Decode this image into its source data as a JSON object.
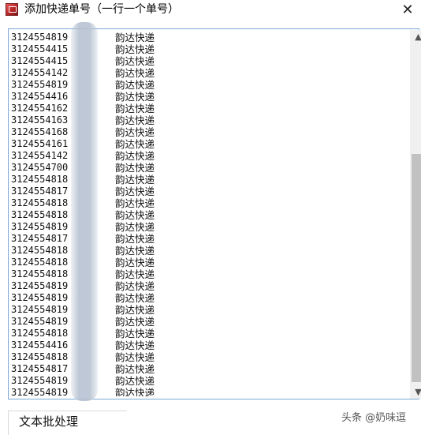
{
  "window": {
    "title": "添加快递单号（一行一个单号）",
    "close_symbol": "✕"
  },
  "tracking_list": {
    "courier": "韵达快递",
    "rows": [
      {
        "number": "3124554819",
        "courier": "韵达快递"
      },
      {
        "number": "3124554415",
        "courier": "韵达快递"
      },
      {
        "number": "3124554415",
        "courier": "韵达快递"
      },
      {
        "number": "3124554142",
        "courier": "韵达快递"
      },
      {
        "number": "3124554819",
        "courier": "韵达快递"
      },
      {
        "number": "3124554416",
        "courier": "韵达快递"
      },
      {
        "number": "3124554162",
        "courier": "韵达快递"
      },
      {
        "number": "3124554163",
        "courier": "韵达快递"
      },
      {
        "number": "3124554168",
        "courier": "韵达快递"
      },
      {
        "number": "3124554161",
        "courier": "韵达快递"
      },
      {
        "number": "3124554142",
        "courier": "韵达快递"
      },
      {
        "number": "3124554700",
        "courier": "韵达快递"
      },
      {
        "number": "3124554818",
        "courier": "韵达快递"
      },
      {
        "number": "3124554817",
        "courier": "韵达快递"
      },
      {
        "number": "3124554818",
        "courier": "韵达快递"
      },
      {
        "number": "3124554818",
        "courier": "韵达快递"
      },
      {
        "number": "3124554819",
        "courier": "韵达快递"
      },
      {
        "number": "3124554817",
        "courier": "韵达快递"
      },
      {
        "number": "3124554818",
        "courier": "韵达快递"
      },
      {
        "number": "3124554818",
        "courier": "韵达快递"
      },
      {
        "number": "3124554818",
        "courier": "韵达快递"
      },
      {
        "number": "3124554819",
        "courier": "韵达快递"
      },
      {
        "number": "3124554819",
        "courier": "韵达快递"
      },
      {
        "number": "3124554819",
        "courier": "韵达快递"
      },
      {
        "number": "3124554819",
        "courier": "韵达快递"
      },
      {
        "number": "3124554818",
        "courier": "韵达快递"
      },
      {
        "number": "3124554416",
        "courier": "韵达快递"
      },
      {
        "number": "3124554818",
        "courier": "韵达快递"
      },
      {
        "number": "3124554817",
        "courier": "韵达快递"
      },
      {
        "number": "3124554819",
        "courier": "韵达快递"
      },
      {
        "number": "3124554819",
        "courier": "韵达快递"
      }
    ]
  },
  "scrollbar": {
    "up_symbol": "▲",
    "down_symbol": "▼",
    "position": 0.6
  },
  "footer": {
    "batch_label": "文本批处理",
    "watermark": "头条 @奶味逗"
  }
}
